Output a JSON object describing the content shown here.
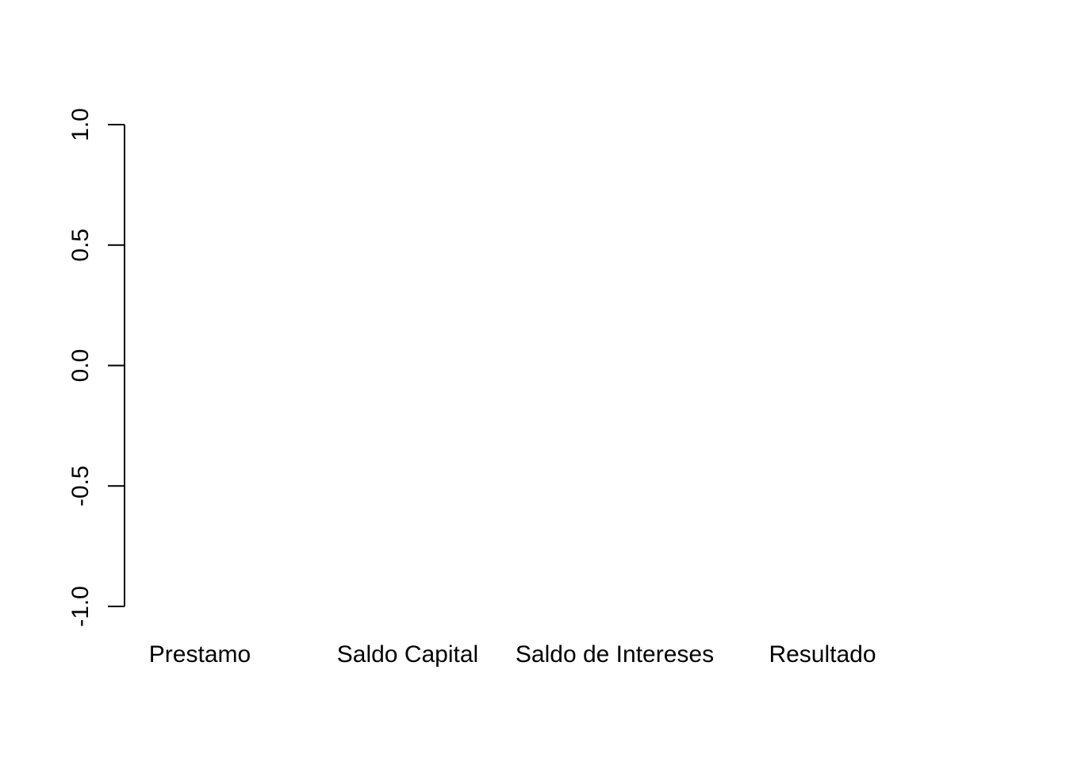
{
  "chart_data": {
    "type": "bar",
    "categories": [
      "Prestamo",
      "Saldo Capital",
      "Saldo de Intereses",
      "Resultado"
    ],
    "values": [],
    "title": "",
    "xlabel": "",
    "ylabel": "",
    "ylim": [
      -1.0,
      1.0
    ],
    "yticks": [
      "-1.0",
      "-0.5",
      "0.0",
      "0.5",
      "1.0"
    ],
    "grid": false,
    "colors": {
      "axis": "#000000",
      "text": "#000000",
      "background": "#ffffff"
    }
  }
}
